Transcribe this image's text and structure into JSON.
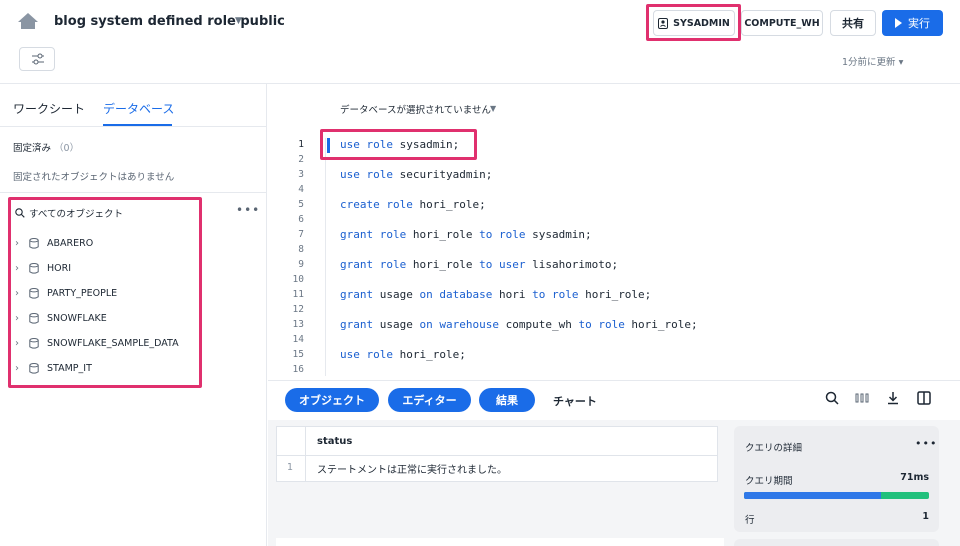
{
  "header": {
    "title": "blog system defined role public",
    "role": "SYSADMIN",
    "warehouse": "COMPUTE_WH",
    "share_label": "共有",
    "run_label": "実行",
    "updated": "1分前に更新"
  },
  "sidebar": {
    "tabs": [
      "ワークシート",
      "データベース"
    ],
    "active_tab": "データベース",
    "pinned_label": "固定済み",
    "pinned_count": "（0）",
    "pinned_empty": "固定されたオブジェクトはありません",
    "all_objects_label": "すべてのオブジェクト",
    "more": "•••",
    "databases": [
      "ABARERO",
      "HORI",
      "PARTY_PEOPLE",
      "SNOWFLAKE",
      "SNOWFLAKE_SAMPLE_DATA",
      "STAMP_IT"
    ]
  },
  "editor": {
    "db_selector": "データベースが選択されていません",
    "line_numbers": [
      "1",
      "2",
      "3",
      "4",
      "5",
      "6",
      "7",
      "8",
      "9",
      "10",
      "11",
      "12",
      "13",
      "14",
      "15",
      "16"
    ],
    "lines": [
      [
        {
          "t": "use role",
          "k": true
        },
        {
          "t": " sysadmin;",
          "k": false
        }
      ],
      [
        {
          "t": "use role",
          "k": true
        },
        {
          "t": " securityadmin;",
          "k": false
        }
      ],
      [
        {
          "t": "create role",
          "k": true
        },
        {
          "t": " hori_role;",
          "k": false
        }
      ],
      [
        {
          "t": "grant role",
          "k": true
        },
        {
          "t": " hori_role ",
          "k": false
        },
        {
          "t": "to role",
          "k": true
        },
        {
          "t": " sysadmin;",
          "k": false
        }
      ],
      [
        {
          "t": "grant role",
          "k": true
        },
        {
          "t": " hori_role ",
          "k": false
        },
        {
          "t": "to user",
          "k": true
        },
        {
          "t": " lisahorimoto;",
          "k": false
        }
      ],
      [
        {
          "t": "grant",
          "k": true
        },
        {
          "t": " usage ",
          "k": false
        },
        {
          "t": "on database",
          "k": true
        },
        {
          "t": " hori ",
          "k": false
        },
        {
          "t": "to role",
          "k": true
        },
        {
          "t": " hori_role;",
          "k": false
        }
      ],
      [
        {
          "t": "grant",
          "k": true
        },
        {
          "t": " usage ",
          "k": false
        },
        {
          "t": "on warehouse",
          "k": true
        },
        {
          "t": " compute_wh ",
          "k": false
        },
        {
          "t": "to role",
          "k": true
        },
        {
          "t": " hori_role;",
          "k": false
        }
      ],
      [
        {
          "t": "use role",
          "k": true
        },
        {
          "t": " hori_role;",
          "k": false
        }
      ]
    ]
  },
  "results": {
    "tabs": {
      "objects": "オブジェクト",
      "editor": "エディター",
      "results": "結果",
      "chart": "チャート"
    },
    "columns": [
      "status"
    ],
    "rows": [
      {
        "index": "1",
        "status": "ステートメントは正常に実行されました。"
      }
    ],
    "detail": {
      "title": "クエリの詳細",
      "more": "•••",
      "duration_label": "クエリ期間",
      "duration_value": "71ms",
      "duration_split": 0.74,
      "rows_label": "行",
      "rows_value": "1"
    }
  },
  "colors": {
    "accent": "#1a6ce8",
    "highlight": "#e0306e",
    "success": "#21c07c"
  }
}
